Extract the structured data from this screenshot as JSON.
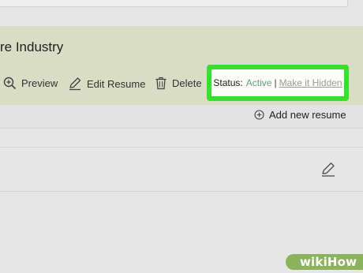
{
  "resume": {
    "title": "re Industry",
    "actions": {
      "preview_label": "Preview",
      "edit_label": "Edit Resume",
      "delete_label": "Delete"
    },
    "status": {
      "label": "Status:",
      "value": "Active",
      "separator": "|",
      "toggle_link": "Make it Hidden"
    },
    "add_new_label": "Add new resume"
  },
  "watermark": {
    "prefix": "wiki",
    "suffix": "How"
  },
  "colors": {
    "highlight": "#33e22a",
    "status_active": "#6b9d7a",
    "card_header": "#d8ddc4"
  },
  "icons": {
    "preview": "zoom-in-icon",
    "edit": "pencil-icon",
    "delete": "trash-icon",
    "add": "plus-circle-icon"
  }
}
